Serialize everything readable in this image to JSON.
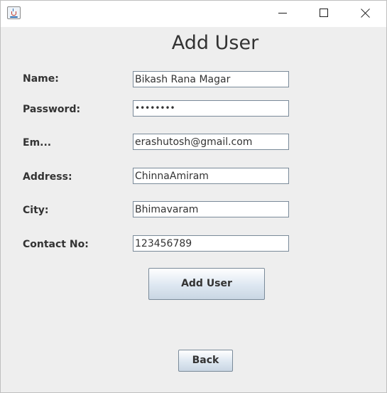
{
  "window": {
    "icon": "java-cup-icon",
    "controls": [
      "minimize-icon",
      "maximize-icon",
      "close-icon"
    ]
  },
  "form": {
    "title": "Add User",
    "fields": [
      {
        "label": "Name:",
        "value": "Bikash Rana Magar"
      },
      {
        "label": "Password:",
        "value": "••••••••"
      },
      {
        "label": "Em...",
        "value": "erashutosh@gmail.com"
      },
      {
        "label": "Address:",
        "value": "ChinnaAmiram"
      },
      {
        "label": "City:",
        "value": "Bhimavaram"
      },
      {
        "label": "Contact No:",
        "value": "123456789"
      }
    ],
    "submit_label": "Add User",
    "back_label": "Back"
  }
}
